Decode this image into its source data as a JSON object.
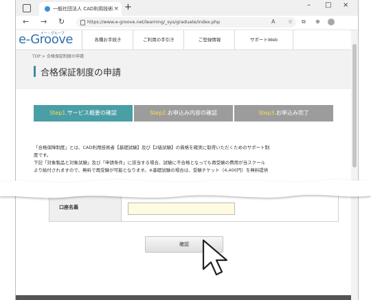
{
  "browser": {
    "tab_title": "一般社団法人 CAD利用技術者試験サポート...",
    "url": "https://www.e-groove.net/learning/_sys/graduate/index.php",
    "new_tab": "+",
    "tab_close": "×",
    "nav_back": "←",
    "nav_forward": "→",
    "nav_reload": "↻",
    "window_min": "–",
    "window_max": "□",
    "window_close": "×",
    "toolbar_read": "A",
    "toolbar_fav": "☆",
    "toolbar_collections": "⧉",
    "toolbar_ext": "⊕"
  },
  "site": {
    "logo": "e-Groove",
    "logo_sub": "イー・グルーブ",
    "nav": [
      "各種お手続き",
      "ご利用の手引き",
      "ご登録情報",
      "サポートWeb"
    ]
  },
  "breadcrumb": "TOP > 合格保証制度の申請",
  "page_title": "合格保証制度の申請",
  "steps": [
    {
      "num": "Step1.",
      "label": "サービス概要の確認"
    },
    {
      "num": "Step2.",
      "label": "お申込み内容の確認"
    },
    {
      "num": "Step3.",
      "label": "お申込み完了"
    }
  ],
  "body": {
    "line1": "「合格保障制度」とは、CAD利用技術者【基礎試験】及び【2級試験】の資格を確実に取得いただくためのサポート制",
    "line2": "度です。",
    "line3": "下記「対象製品と対象試験」及び「申請条件」に該当する場合、試験に不合格となっても再受験の費用が当スクール",
    "line4": "より給付されますので、無料で再受験が可能となります。※基礎試験の場合は、受験チケット（4,400円）を無料提供"
  },
  "form": {
    "account_label": "口座名義",
    "account_value": ""
  },
  "confirm_button": "確認",
  "colors": {
    "active_step": "#4a9ea6",
    "inactive_step": "#9c9c9c",
    "step_number": "#ffdd55",
    "accent": "#3c8c99",
    "logo": "#2f6fae"
  }
}
